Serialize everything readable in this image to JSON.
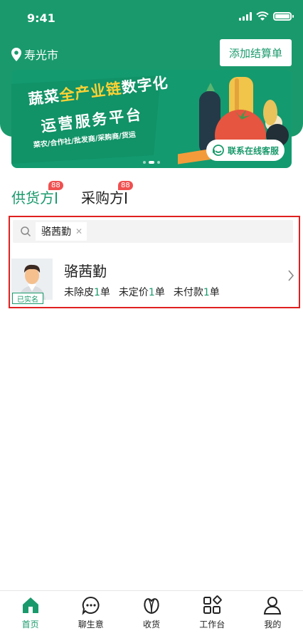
{
  "status_bar": {
    "time": "9:41"
  },
  "header": {
    "location": "寿光市",
    "add_button": "添加结算单"
  },
  "banner": {
    "title_prefix": "蔬菜",
    "title_highlight": "全产业链",
    "title_suffix": "数字化",
    "title_line2": "运营服务平台",
    "subtitle": "菜农/合作社/批发商/采购商/货运",
    "service_button": "联系在线客服"
  },
  "tabs": [
    {
      "label": "供货方",
      "badge": "88",
      "active": true
    },
    {
      "label": "采购方",
      "badge": "88",
      "active": false
    }
  ],
  "search": {
    "chip": "骆茜勤"
  },
  "result": {
    "name": "骆茜勤",
    "verified": "已实名",
    "stats": [
      {
        "label": "未除皮",
        "count": "1",
        "unit": "单"
      },
      {
        "label": "未定价",
        "count": "1",
        "unit": "单"
      },
      {
        "label": "未付款",
        "count": "1",
        "unit": "单"
      }
    ]
  },
  "bottom_nav": [
    {
      "label": "首页",
      "icon": "home-icon",
      "active": true
    },
    {
      "label": "聊生意",
      "icon": "chat-icon",
      "active": false
    },
    {
      "label": "收货",
      "icon": "receive-icon",
      "active": false
    },
    {
      "label": "工作台",
      "icon": "workbench-icon",
      "active": false
    },
    {
      "label": "我的",
      "icon": "profile-icon",
      "active": false
    }
  ],
  "colors": {
    "brand": "#1a9a6c",
    "badge": "#f05050",
    "highlight_border": "#e02020",
    "banner_yellow": "#ffd234"
  }
}
